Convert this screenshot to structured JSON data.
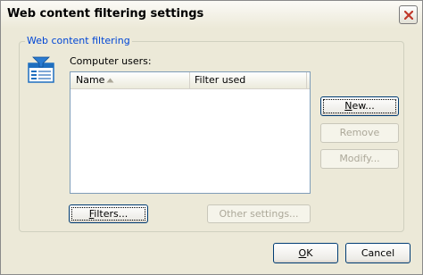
{
  "window": {
    "title": "Web content filtering settings"
  },
  "group": {
    "legend": "Web content filtering"
  },
  "users": {
    "label": "Computer users:",
    "columns": [
      {
        "label": "Name",
        "sorted": "ascending"
      },
      {
        "label": "Filter used"
      }
    ],
    "rows": []
  },
  "side_buttons": {
    "new": "New...",
    "remove": "Remove",
    "modify": "Modify..."
  },
  "bottom_buttons": {
    "filters": "Filters...",
    "other_settings": "Other settings..."
  },
  "dialog_buttons": {
    "ok": "OK",
    "cancel": "Cancel"
  },
  "colors": {
    "accent": "#0046D5",
    "close_icon": "#C0392B",
    "app_icon": "#1F6FBF"
  },
  "icons": {
    "close": "close-icon",
    "app": "web-filter-icon",
    "sort": "sort-ascending-icon"
  }
}
